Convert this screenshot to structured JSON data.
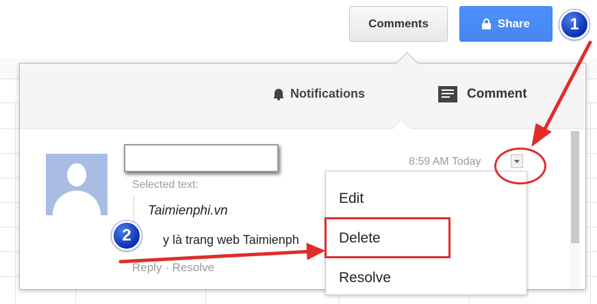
{
  "header": {
    "comments_label": "Comments",
    "share_label": "Share"
  },
  "panel": {
    "notifications_label": "Notifications",
    "comment_label": "Comment"
  },
  "comment": {
    "selected_text_label": "Selected text:",
    "quoted_text": "Taimienphi.vn",
    "body_text": "y là trang web Taimienph",
    "reply_label": "Reply",
    "separator": "·",
    "resolve_label": "Resolve",
    "timestamp": "8:59 AM Today"
  },
  "menu": {
    "items": [
      "Edit",
      "Delete",
      "Resolve"
    ]
  },
  "annotations": {
    "step1": "1",
    "step2": "2",
    "highlight_color": "#e02c2c"
  },
  "colors": {
    "share_blue": "#4d90fe",
    "badge_blue": "#0b2fb3"
  },
  "icons": {
    "share": "lock-icon",
    "notifications": "bell-icon",
    "comment": "comment-icon",
    "avatar": "user-avatar",
    "dropdown": "chevron-down-icon"
  }
}
